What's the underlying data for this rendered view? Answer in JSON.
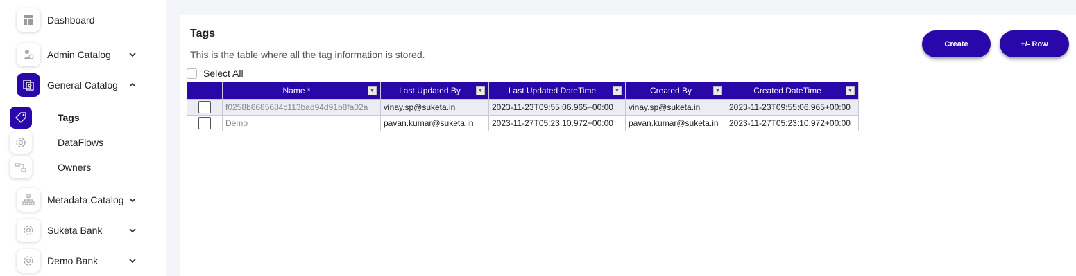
{
  "sidebar": {
    "items": [
      {
        "label": "Dashboard",
        "icon": "dashboard-icon"
      },
      {
        "label": "Admin Catalog",
        "icon": "admin-icon"
      },
      {
        "label": "General Catalog",
        "icon": "catalog-icon"
      },
      {
        "label": "Metadata Catalog",
        "icon": "metadata-icon"
      },
      {
        "label": "Suketa Bank",
        "icon": "gear-icon"
      },
      {
        "label": "Demo Bank",
        "icon": "gear-icon"
      }
    ],
    "sub_items": [
      {
        "label": "Tags",
        "icon": "tag-icon"
      },
      {
        "label": "DataFlows",
        "icon": "gear-icon"
      },
      {
        "label": "Owners",
        "icon": "owners-icon"
      }
    ]
  },
  "main": {
    "title": "Tags",
    "description": "This is the table where all the tag information is stored.",
    "select_all_label": "Select All",
    "buttons": {
      "create": "Create",
      "row": "+/- Row"
    },
    "table": {
      "columns": [
        "Name *",
        "Last Updated By",
        "Last Updated DateTime",
        "Created By",
        "Created DateTime"
      ],
      "rows": [
        {
          "name": "f0258b6685684c113bad94d91b8fa02a",
          "last_updated_by": "vinay.sp@suketa.in",
          "last_updated": "2023-11-23T09:55:06.965+00:00",
          "created_by": "vinay.sp@suketa.in",
          "created": "2023-11-23T09:55:06.965+00:00"
        },
        {
          "name": "Demo",
          "last_updated_by": "pavan.kumar@suketa.in",
          "last_updated": "2023-11-27T05:23:10.972+00:00",
          "created_by": "pavan.kumar@suketa.in",
          "created": "2023-11-27T05:23:10.972+00:00"
        }
      ]
    }
  },
  "colors": {
    "accent": "#2a07a8"
  }
}
